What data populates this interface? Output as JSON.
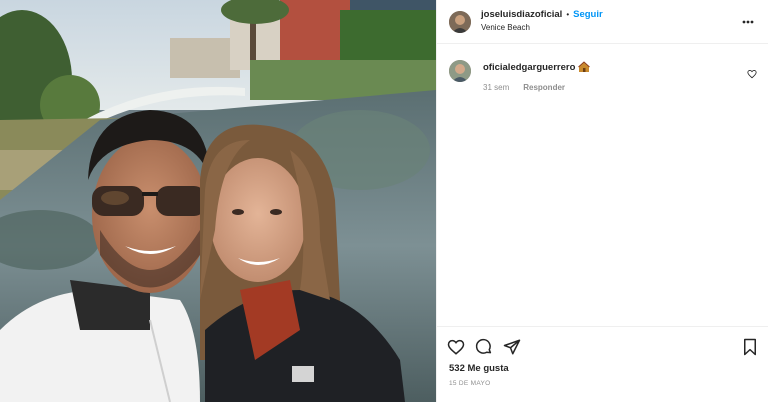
{
  "post": {
    "author": "joseluisdiazoficial",
    "separator": "•",
    "follow_label": "Seguir",
    "location": "Venice Beach",
    "more_icon": "more-horizontal-icon"
  },
  "comments": [
    {
      "author": "oficialedgarguerrero",
      "emoji": "house-emoji",
      "age": "31 sem",
      "reply_label": "Responder",
      "like_icon": "heart-outline-icon"
    }
  ],
  "actions": {
    "like_icon": "heart-outline-icon",
    "comment_icon": "speech-bubble-icon",
    "share_icon": "paper-plane-icon",
    "save_icon": "bookmark-icon"
  },
  "likes_text": "532 Me gusta",
  "date_text": "15 DE MAYO",
  "colors": {
    "accent": "#0095f6",
    "text": "#262626",
    "muted": "#8e8e8e",
    "divider": "#efefef"
  }
}
